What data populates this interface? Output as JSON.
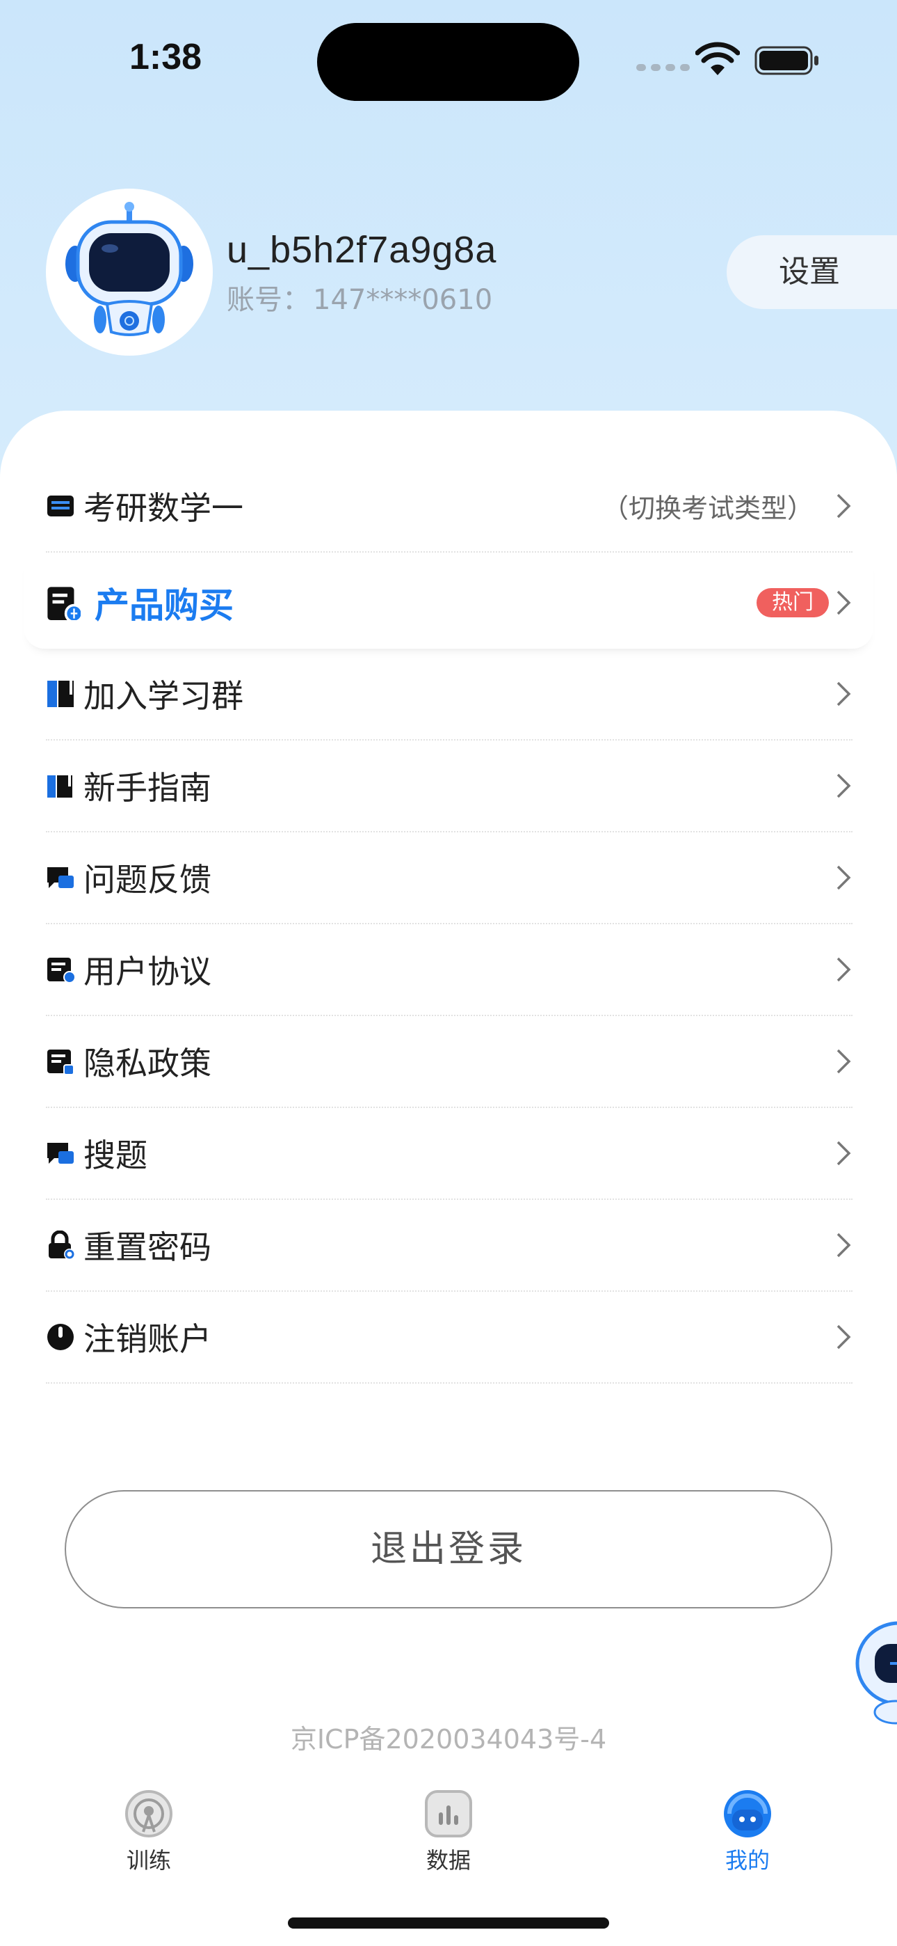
{
  "status_bar": {
    "time": "1:38"
  },
  "profile": {
    "username": "u_b5h2f7a9g8a",
    "account_label": "账号：",
    "account_value": "147****0610",
    "settings_label": "设置"
  },
  "menu": {
    "exam_type": {
      "label": "考研数学一",
      "hint": "（切换考试类型）"
    },
    "items": [
      {
        "label": "产品购买",
        "badge": "热门"
      },
      {
        "label": "加入学习群"
      },
      {
        "label": "新手指南"
      },
      {
        "label": "问题反馈"
      },
      {
        "label": "用户协议"
      },
      {
        "label": "隐私政策"
      },
      {
        "label": "搜题"
      },
      {
        "label": "重置密码"
      },
      {
        "label": "注销账户"
      }
    ]
  },
  "logout_label": "退出登录",
  "icp_text": "京ICP备2020034043号-4",
  "tabs": [
    {
      "label": "训练",
      "icon": "radar-icon"
    },
    {
      "label": "数据",
      "icon": "bar-chart-icon"
    },
    {
      "label": "我的",
      "icon": "robot-face-icon",
      "active": true
    }
  ],
  "colors": {
    "accent": "#1b7cf0",
    "hot_badge": "#f0605e",
    "header_bg": "#cbe6fb"
  }
}
